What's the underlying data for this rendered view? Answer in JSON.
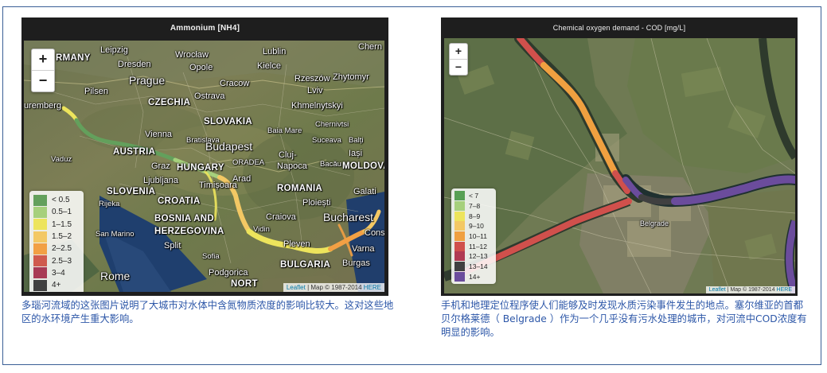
{
  "left_panel": {
    "title": "Ammonium [NH4]",
    "zoom_in": "+",
    "zoom_out": "−",
    "legend": [
      {
        "label": "< 0.5",
        "color": "#63a05c"
      },
      {
        "label": "0.5–1",
        "color": "#a6d07c"
      },
      {
        "label": "1–1.5",
        "color": "#ede45c"
      },
      {
        "label": "1.5–2",
        "color": "#f3c864"
      },
      {
        "label": "2–2.5",
        "color": "#f2a044"
      },
      {
        "label": "2.5–3",
        "color": "#cf5a4e"
      },
      {
        "label": "3–4",
        "color": "#a83a55"
      },
      {
        "label": "4+",
        "color": "#404040"
      }
    ],
    "attribution": {
      "leaflet": "Leaflet",
      "map": " | Map © 1987-2014 ",
      "here": "HERE"
    },
    "map_labels": {
      "germany": "RMANY",
      "leipzig": "Leipzig",
      "wroclaw": "Wrocław",
      "lublin": "Lublin",
      "chern": "Chern",
      "dresden": "Dresden",
      "opole": "Opole",
      "kielce": "Kielce",
      "rzeszow": "Rzeszów",
      "zhytomyr": "Zhytomyr",
      "prague": "Prague",
      "cracow": "Cracow",
      "pilsen": "Pilsen",
      "czechia": "CZECHIA",
      "ostrava": "Ostrava",
      "lviv": "Lviv",
      "khmelnytskyi": "Khmelnytskyi",
      "nuremberg": "uremberg",
      "slovakia": "SLOVAKIA",
      "chernivtsi": "Chernivtsi",
      "balti": "Balți",
      "vienna": "Vienna",
      "bratislava": "Bratislava",
      "baia_mare": "Baia Mare",
      "suceava": "Suceava",
      "austria": "AUSTRIA",
      "budapest": "Budapest",
      "iasi": "Iași",
      "cluj": "Cluj-",
      "napoca": "Napoca",
      "bacau": "Bacău",
      "moldova": "MOLDOVA",
      "vaduz": "Vaduz",
      "graz": "Graz",
      "hungary": "HUNGARY",
      "oradea": "ORADEA",
      "ljubljana": "Ljubljana",
      "timisoara": "Timișoara",
      "arad": "Arad",
      "romania": "ROMANIA",
      "slovenia": "SLOVENIA",
      "galati": "Galati",
      "rijeka": "Rijeka",
      "croatia": "CROATIA",
      "ploiesti": "Ploiești",
      "bucharest": "Bucharest",
      "bosnia": "BOSNIA AND",
      "herzegovina": "HERZEGOVINA",
      "craiova": "Craiova",
      "cons": "Cons",
      "san_marino": "San Marino",
      "split": "Split",
      "pleven": "Pleven",
      "varna": "Varna",
      "bulgaria": "BULGARIA",
      "burgas": "Burgas",
      "rome": "Rome",
      "podgorica": "Podgorica",
      "north": "NORT",
      "sofia": "Sofia",
      "vidin": "Vidin"
    }
  },
  "right_panel": {
    "title": "Chemical oxygen demand - COD [mg/L]",
    "zoom_in": "+",
    "zoom_out": "−",
    "legend": [
      {
        "label": "< 7",
        "color": "#58a054"
      },
      {
        "label": "7–8",
        "color": "#a6d07c"
      },
      {
        "label": "8–9",
        "color": "#ede45c"
      },
      {
        "label": "9–10",
        "color": "#f3c864"
      },
      {
        "label": "10–11",
        "color": "#f0a040"
      },
      {
        "label": "11–12",
        "color": "#d0504c"
      },
      {
        "label": "12–13",
        "color": "#b03a52"
      },
      {
        "label": "13–14",
        "color": "#404040"
      },
      {
        "label": "14+",
        "color": "#6b4c9c"
      }
    ],
    "attribution": {
      "leaflet": "Leaflet",
      "map": " | Map © 1987-2014 ",
      "here": "HERE"
    },
    "map_labels": {
      "belgrade": "Belgrade"
    }
  },
  "captions": {
    "left": "多瑙河流域的这张图片说明了大城市对水体中含氮物质浓度的影响比较大。这对这些地区的水环境产生重大影响。",
    "right": "手机和地理定位程序使人们能够及时发现水质污染事件发生的地点。塞尔维亚的首都贝尔格莱德（ Belgrade ）作为一个几乎没有污水处理的城市，对河流中COD浓度有明显的影响。"
  }
}
